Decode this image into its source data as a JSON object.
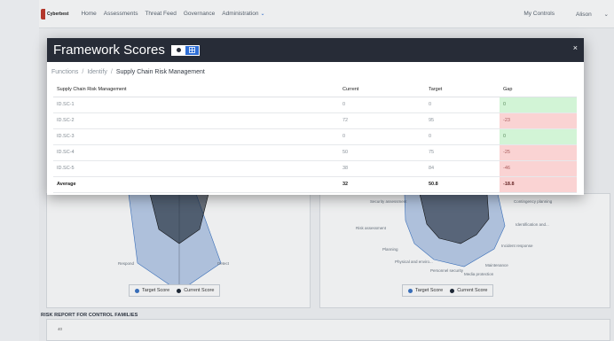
{
  "nav": {
    "logo_text": "Cyberbest",
    "items": [
      "Home",
      "Assessments",
      "Threat Feed",
      "Governance",
      "Administration"
    ],
    "right_items": [
      "My Controls",
      "Alison"
    ]
  },
  "modal": {
    "title": "Framework Scores",
    "close_label": "×",
    "breadcrumb": [
      "Functions",
      "Identify",
      "Supply Chain Risk Management"
    ],
    "table": {
      "headers": [
        "Supply Chain Risk Management",
        "Current",
        "Target",
        "Gap"
      ],
      "rows": [
        {
          "id": "ID.SC-1",
          "current": "0",
          "target": "0",
          "gap": "0",
          "status": "good"
        },
        {
          "id": "ID.SC-2",
          "current": "72",
          "target": "95",
          "gap": "-23",
          "status": "bad"
        },
        {
          "id": "ID.SC-3",
          "current": "0",
          "target": "0",
          "gap": "0",
          "status": "good"
        },
        {
          "id": "ID.SC-4",
          "current": "50",
          "target": "75",
          "gap": "-25",
          "status": "bad"
        },
        {
          "id": "ID.SC-5",
          "current": "38",
          "target": "84",
          "gap": "-46",
          "status": "bad"
        }
      ],
      "average": {
        "label": "Average",
        "current": "32",
        "target": "50.8",
        "gap": "-18.8"
      }
    }
  },
  "background": {
    "left_chart": {
      "labels": [
        "Respond",
        "Detect"
      ],
      "legend": [
        "Target Score",
        "Current Score"
      ]
    },
    "right_chart": {
      "labels": [
        "Security assessment",
        "Risk assessment",
        "Planning",
        "Physical and enviro...",
        "Personnel security",
        "Media protection",
        "Maintenance",
        "Incident response",
        "Identification and...",
        "Contingency planning"
      ],
      "legend": [
        "Target Score",
        "Current Score"
      ]
    },
    "risk_report_title": "RISK REPORT FOR CONTROL FAMILIES",
    "risk_tick": "40"
  },
  "colors": {
    "modal_header": "#272c37",
    "target_series": "#3b74c4",
    "current_series": "#1f2937",
    "gap_good": "#d2f4d6",
    "gap_bad": "#fad3d3"
  }
}
